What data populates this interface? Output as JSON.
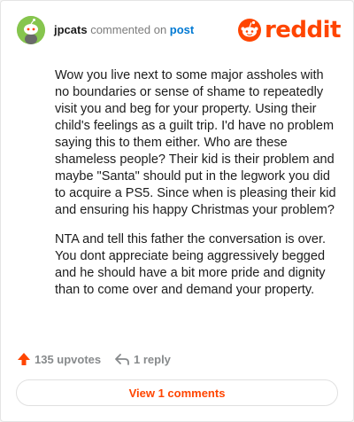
{
  "comment": {
    "username": "jpcats",
    "action_text": " commented on ",
    "link_text": "post",
    "paragraphs": [
      "Wow you live next to some major assholes with no boundaries or sense of shame to repeatedly visit you and beg for your property. Using their child's feelings as a guilt trip. I'd have no problem saying this to them either. Who are these shameless people? Their kid is their problem and maybe \"Santa\" should put in the legwork you did to acquire a PS5. Since when is pleasing their kid and ensuring his happy Christmas your problem?",
      "NTA and tell this father the conversation is over. You dont appreciate being aggressively begged and he should have a bit more pride and dignity than to come over and demand your property."
    ]
  },
  "logo": {
    "text": "reddit",
    "icon": "reddit-alien-icon"
  },
  "actions": {
    "upvotes_label": "135 upvotes",
    "upvote_icon": "upvote-arrow-icon",
    "reply_label": "1 reply",
    "reply_icon": "reply-arrow-icon"
  },
  "view_comments_label": "View 1 comments",
  "colors": {
    "brand": "#ff4500",
    "link": "#0079d3",
    "avatar_bg": "#86c54e",
    "text": "#1c1c1c",
    "muted": "#878a8c"
  }
}
